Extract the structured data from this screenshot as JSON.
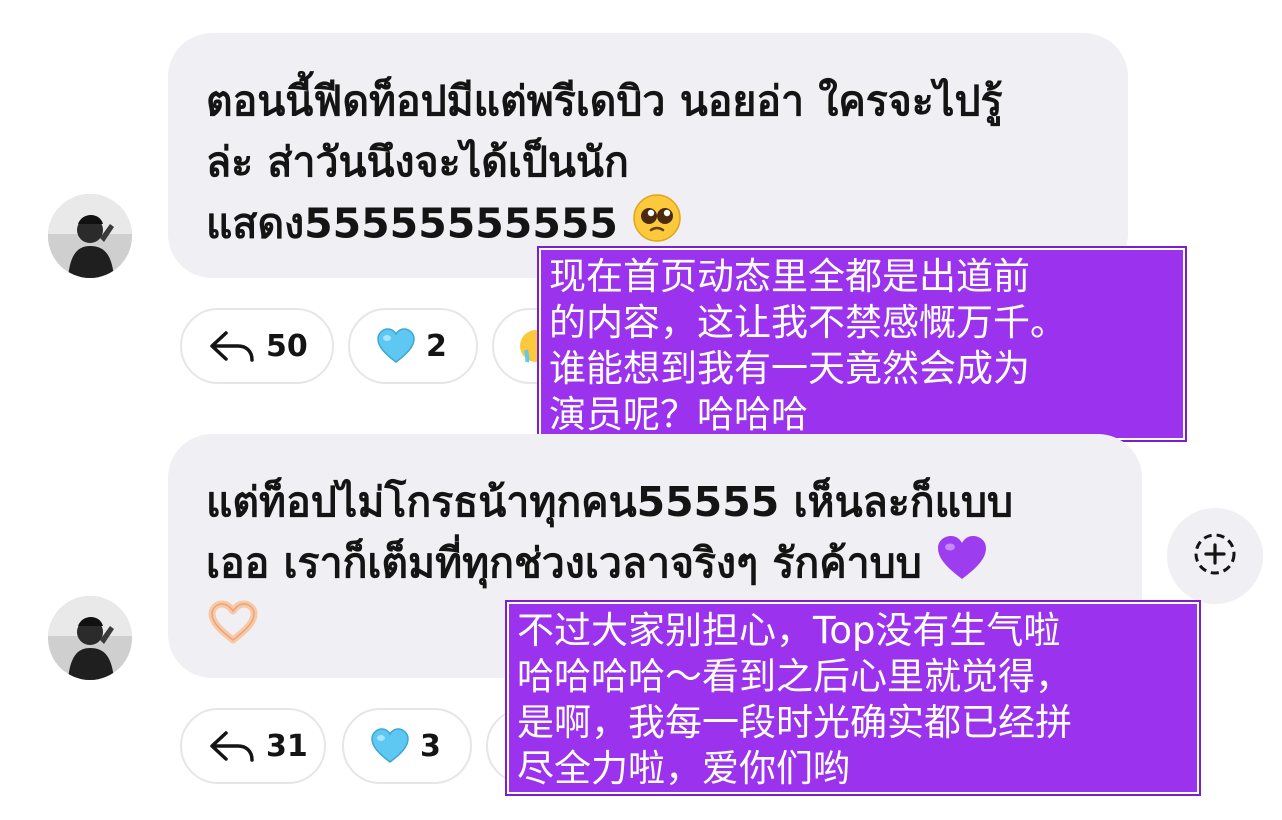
{
  "comments": [
    {
      "text": "ตอนนี้ฟีดท็อปมีแต่พรีเดบิว นอยอ่า ใครจะไปรู้ ล่ะ ส่าวันนึงจะได้เป็นนัก แสดง55555555555",
      "lines": [
        "ตอนนี้ฟีดท็อปมีแต่พรีเดบิว นอยอ่า ใครจะไปรู้",
        "ล่ะ ส่าวันนึงจะได้เป็นนัก",
        "แสดง55555555555"
      ],
      "emoji": "pleading-face",
      "actions": {
        "reply_count": "50",
        "like_count": "2"
      },
      "translation": "现在首页动态里全都是出道前的内容，这让我不禁感慨万千。谁能想到我有一天竟然会成为演员呢？哈哈哈",
      "translation_lines": [
        "现在首页动态里全都是出道前",
        "的内容，这让我不禁感慨万千。",
        "谁能想到我有一天竟然会成为",
        "演员呢？哈哈哈"
      ]
    },
    {
      "text": "แต่ท็อปไม่โกรธน้าทุกคน55555 เห็นละก็แบบ เออ เราก็เต็มที่ทุกช่วงเวลาจริงๆ รักค้าบบ",
      "lines": [
        "แต่ท็อปไม่โกรธน้าทุกคน55555 เห็นละก็แบบ",
        "เออ เราก็เต็มที่ทุกช่วงเวลาจริงๆ รักค้าบบ"
      ],
      "emoji": "purple-heart",
      "emoji2": "heart-hands",
      "actions": {
        "reply_count": "31",
        "like_count": "3"
      },
      "translation": "不过大家别担心，Top没有生气啦哈哈哈哈～看到之后心里就觉得，是啊，我每一段时光确实都已经拼尽全力啦，爱你们哟",
      "translation_lines": [
        "不过大家别担心，Top没有生气啦",
        "哈哈哈哈～看到之后心里就觉得，",
        "是啊，我每一段时光确实都已经拼",
        "尽全力啦，爱你们哟"
      ]
    }
  ],
  "colors": {
    "bubble": "#efeff4",
    "overlay": "#9b33ee",
    "heart": "#5ec8f2"
  },
  "icons": {
    "reply": "reply-arrow-icon",
    "like": "light-blue-heart-icon",
    "add": "add-reaction-icon"
  }
}
